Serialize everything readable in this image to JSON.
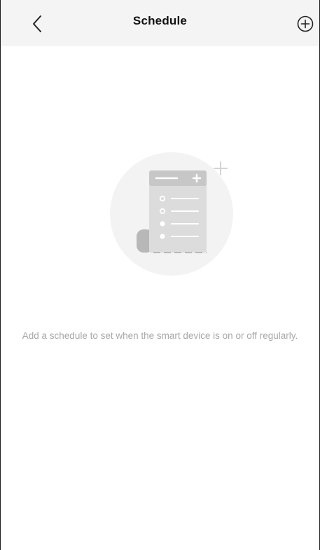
{
  "header": {
    "title": "Schedule",
    "back_icon": "chevron-left-icon",
    "add_icon": "plus-circle-icon"
  },
  "empty_state": {
    "illustration_icon": "schedule-list-illustration",
    "message": "Add a schedule to set when the smart device is on or off regularly."
  },
  "colors": {
    "header_bg": "#f4f4f4",
    "text_primary": "#111111",
    "text_muted": "#a8a8a8",
    "illustration_circle": "#f3f3f3",
    "illustration_paper": "#dcdcdc",
    "illustration_dark": "#b8b8b8"
  }
}
